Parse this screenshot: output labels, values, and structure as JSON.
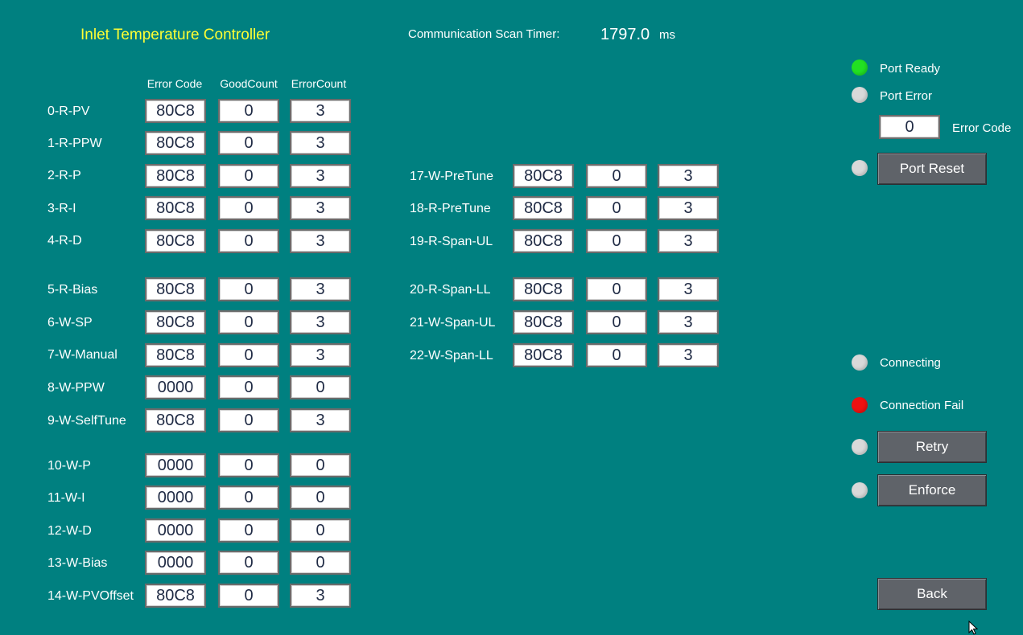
{
  "header": {
    "title": "Inlet Temperature Controller",
    "scan_label": "Communication Scan Timer:",
    "scan_value": "1797.0",
    "scan_unit": "ms"
  },
  "columns": {
    "error_code": "Error Code",
    "good_count": "GoodCount",
    "error_count": "ErrorCount"
  },
  "rows_left": [
    {
      "label": "0-R-PV",
      "err": "80C8",
      "good": "0",
      "cnt": "3"
    },
    {
      "label": "1-R-PPW",
      "err": "80C8",
      "good": "0",
      "cnt": "3"
    },
    {
      "label": "2-R-P",
      "err": "80C8",
      "good": "0",
      "cnt": "3"
    },
    {
      "label": "3-R-I",
      "err": "80C8",
      "good": "0",
      "cnt": "3"
    },
    {
      "label": "4-R-D",
      "err": "80C8",
      "good": "0",
      "cnt": "3"
    },
    {
      "label": "5-R-Bias",
      "err": "80C8",
      "good": "0",
      "cnt": "3"
    },
    {
      "label": "6-W-SP",
      "err": "80C8",
      "good": "0",
      "cnt": "3"
    },
    {
      "label": "7-W-Manual",
      "err": "80C8",
      "good": "0",
      "cnt": "3"
    },
    {
      "label": "8-W-PPW",
      "err": "0000",
      "good": "0",
      "cnt": "0"
    },
    {
      "label": "9-W-SelfTune",
      "err": "80C8",
      "good": "0",
      "cnt": "3"
    },
    {
      "label": "10-W-P",
      "err": "0000",
      "good": "0",
      "cnt": "0"
    },
    {
      "label": "11-W-I",
      "err": "0000",
      "good": "0",
      "cnt": "0"
    },
    {
      "label": "12-W-D",
      "err": "0000",
      "good": "0",
      "cnt": "0"
    },
    {
      "label": "13-W-Bias",
      "err": "0000",
      "good": "0",
      "cnt": "0"
    },
    {
      "label": "14-W-PVOffset",
      "err": "80C8",
      "good": "0",
      "cnt": "3"
    }
  ],
  "rows_right": [
    {
      "label": "17-W-PreTune",
      "err": "80C8",
      "good": "0",
      "cnt": "3"
    },
    {
      "label": "18-R-PreTune",
      "err": "80C8",
      "good": "0",
      "cnt": "3"
    },
    {
      "label": "19-R-Span-UL",
      "err": "80C8",
      "good": "0",
      "cnt": "3"
    },
    {
      "label": "20-R-Span-LL",
      "err": "80C8",
      "good": "0",
      "cnt": "3"
    },
    {
      "label": "21-W-Span-UL",
      "err": "80C8",
      "good": "0",
      "cnt": "3"
    },
    {
      "label": "22-W-Span-LL",
      "err": "80C8",
      "good": "0",
      "cnt": "3"
    }
  ],
  "status": {
    "port_ready": {
      "label": "Port Ready",
      "color": "#22e022"
    },
    "port_error": {
      "label": "Port Error",
      "color": "#d9d9d9"
    },
    "error_code_value": "0",
    "error_code_label": "Error Code",
    "port_reset_led_color": "#d9d9d9",
    "port_reset_button": "Port Reset",
    "connecting": {
      "label": "Connecting",
      "color": "#d9d9d9"
    },
    "connection_fail": {
      "label": "Connection Fail",
      "color": "#ee1111"
    },
    "retry_led_color": "#d9d9d9",
    "retry_button": "Retry",
    "enforce_led_color": "#d9d9d9",
    "enforce_button": "Enforce",
    "back_button": "Back"
  }
}
